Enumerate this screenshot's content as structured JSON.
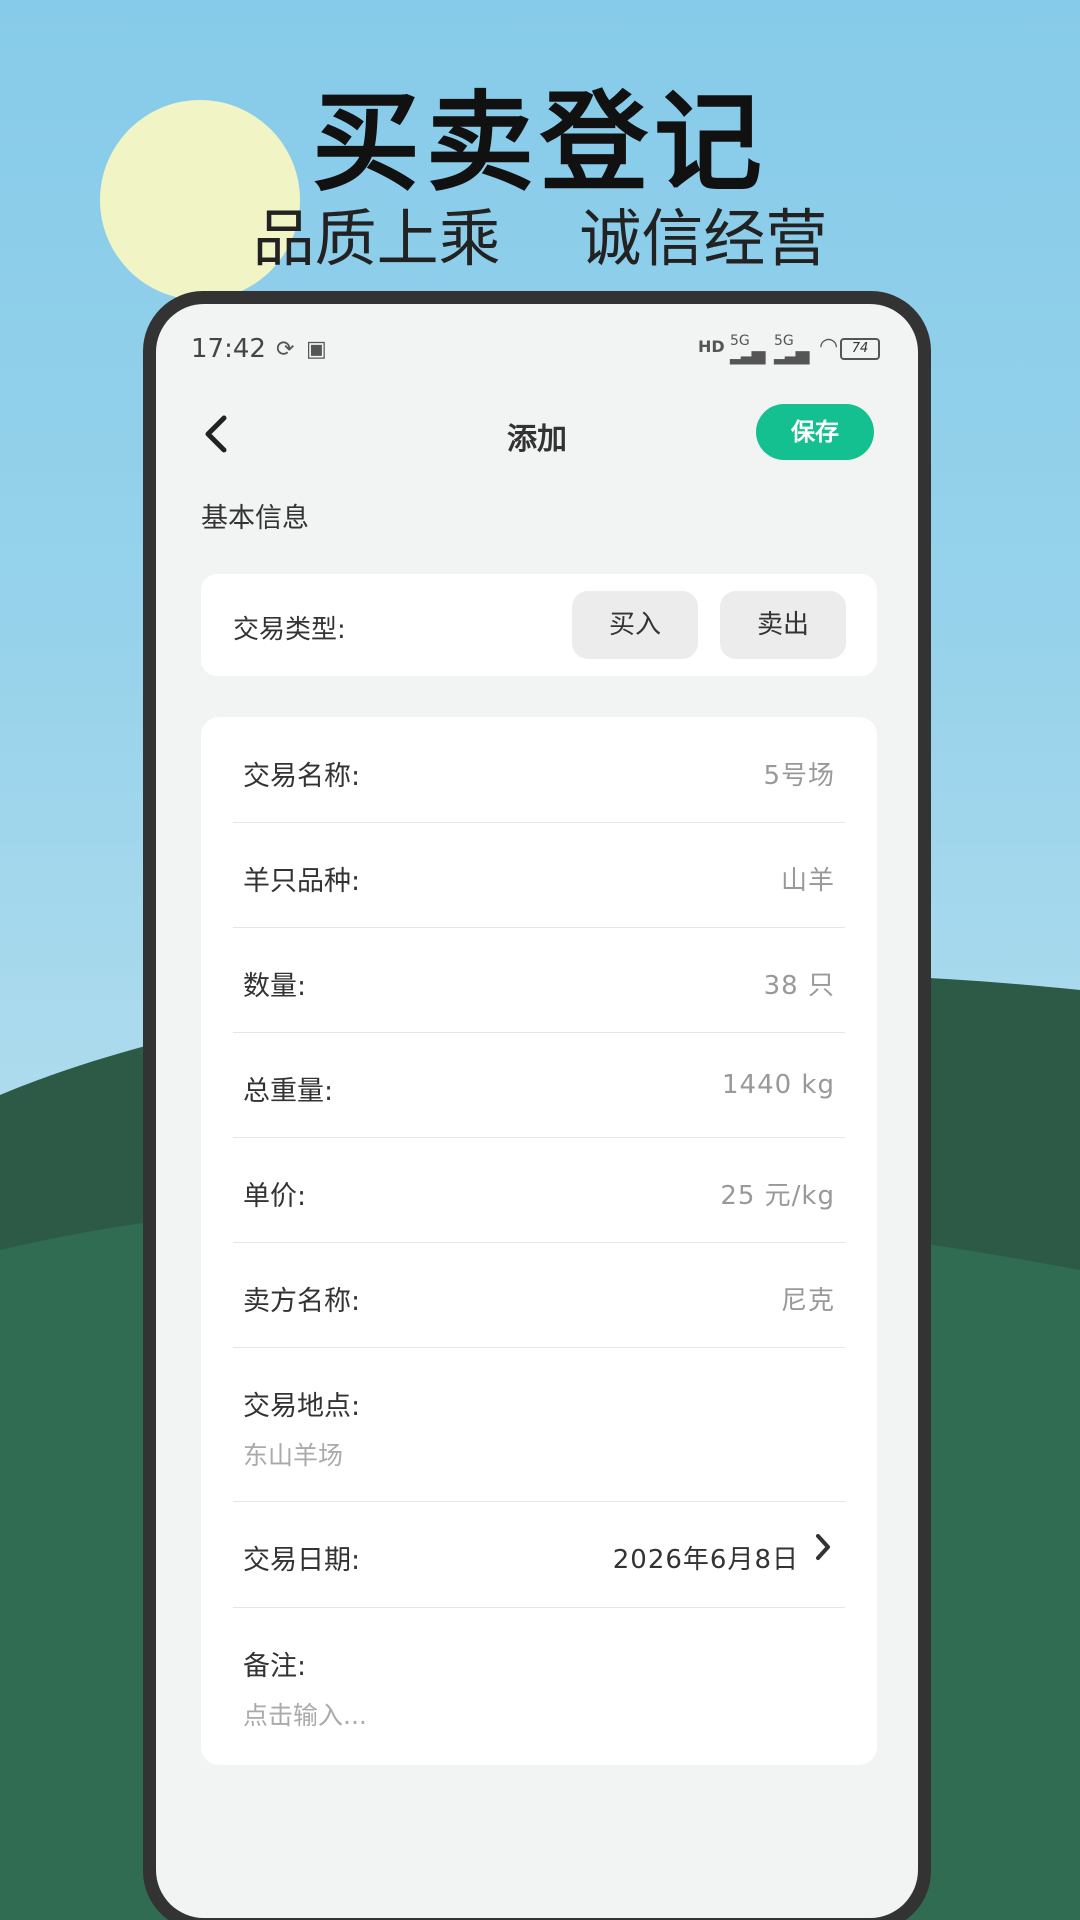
{
  "promo": {
    "title": "买卖登记",
    "subtitle": "品质上乘    诚信经营"
  },
  "statusbar": {
    "time": "17:42",
    "hd_label": "HD",
    "sim1": "5G",
    "sim2": "5G",
    "battery": "74"
  },
  "nav": {
    "title": "添加",
    "save_label": "保存"
  },
  "section": {
    "title": "基本信息"
  },
  "trade_type": {
    "label": "交易类型:",
    "buy": "买入",
    "sell": "卖出"
  },
  "form": {
    "name": {
      "label": "交易名称:",
      "value": "5号场"
    },
    "breed": {
      "label": "羊只品种:",
      "value": "山羊"
    },
    "quantity": {
      "label": "数量:",
      "value": "38 只"
    },
    "weight": {
      "label": "总重量:",
      "value": "1440 kg"
    },
    "price": {
      "label": "单价:",
      "value": "25 元/kg"
    },
    "seller": {
      "label": "卖方名称:",
      "value": "尼克"
    },
    "location": {
      "label": "交易地点:",
      "value": "东山羊场"
    },
    "date": {
      "label": "交易日期:",
      "value": "2026年6月8日"
    },
    "notes": {
      "label": "备注:",
      "placeholder": "点击输入..."
    }
  },
  "colors": {
    "accent": "#14c08f",
    "sky": "#86cbe9",
    "hill_dark": "#2c5a47",
    "hill_light": "#2f6c52",
    "sun": "#f1f4c4"
  }
}
